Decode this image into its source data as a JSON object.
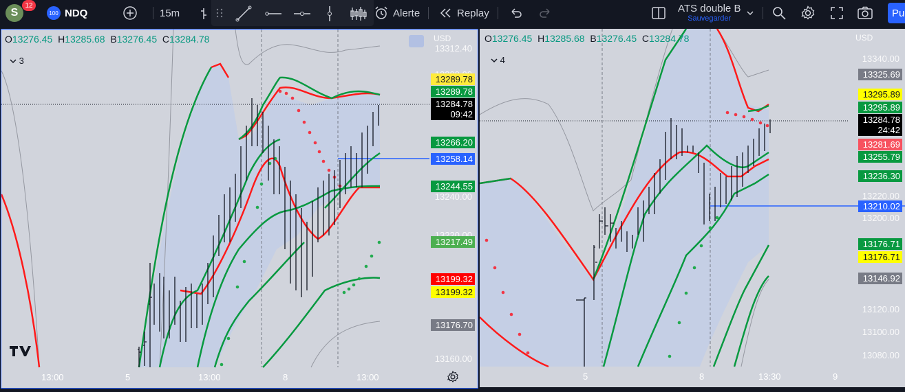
{
  "topbar": {
    "avatar_letter": "S",
    "notifications": "12",
    "symbol_badge": "100",
    "symbol": "NDQ",
    "interval": "15m",
    "alert_label": "Alerte",
    "replay_label": "Replay",
    "layout_name": "ATS double B",
    "layout_status": "Sauvegarder",
    "publish_label": "Pu"
  },
  "colors": {
    "up": "#089981",
    "down": "#f23645",
    "accent": "#2962ff",
    "band_green": "#089940",
    "band_red": "#ff1a1a"
  },
  "left": {
    "ohlc": {
      "o_label": "O",
      "o": "13276.45",
      "h_label": "H",
      "h": "13285.68",
      "b_label": "B",
      "b": "13276.45",
      "c_label": "C",
      "c": "13284.78"
    },
    "legend_count": "3",
    "currency": "USD",
    "ticks": [
      "13312.40",
      "13300.00",
      "13240.00",
      "13220.00",
      "13160.00"
    ],
    "labels": {
      "l1": "13289.78",
      "l2": "13289.78",
      "last": "13284.78",
      "countdown": "09:42",
      "l4": "13266.20",
      "line": "13258.14",
      "l6": "13244.55",
      "l7": "13217.49",
      "l8": "13199.32",
      "l9": "13199.32",
      "l10": "13176.70"
    },
    "xaxis": [
      "13:00",
      "5",
      "13:00",
      "8",
      "13:00"
    ]
  },
  "right": {
    "ohlc": {
      "o_label": "O",
      "o": "13276.45",
      "h_label": "H",
      "h": "13285.68",
      "b_label": "B",
      "b": "13276.45",
      "c_label": "C",
      "c": "13284.78"
    },
    "legend_count": "4",
    "currency": "USD",
    "ticks": [
      "13340.00",
      "13220.00",
      "13200.00",
      "13120.00",
      "13100.00",
      "13080.00"
    ],
    "labels": {
      "l1": "13325.69",
      "l2": "13295.89",
      "l3": "13295.89",
      "last": "13284.78",
      "countdown": "24:42",
      "l5": "13281.69",
      "l6": "13255.79",
      "l7": "13236.30",
      "line": "13210.02",
      "l9": "13176.71",
      "l10": "13176.71",
      "l11": "13146.92"
    },
    "xaxis": [
      "5",
      "8",
      "13:30",
      "9"
    ]
  }
}
